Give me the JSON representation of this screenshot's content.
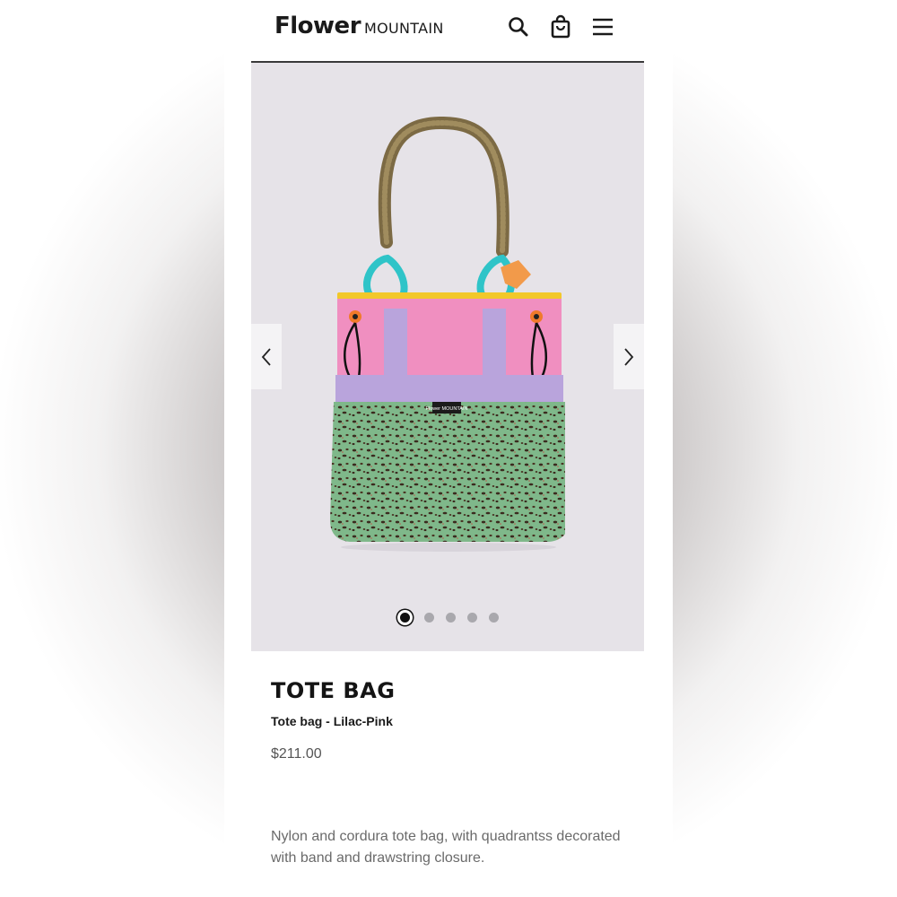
{
  "header": {
    "logo_primary": "Flower",
    "logo_secondary": "MOUNTAIN",
    "icons": [
      "search-icon",
      "shopping-bag-icon",
      "menu-icon"
    ]
  },
  "gallery": {
    "image_alt": "Tote bag - Lilac-Pink",
    "bag_label_text": "Flower MOUNTAIN",
    "slide_count": 5,
    "active_slide": 1,
    "prev_icon": "chevron-left-icon",
    "next_icon": "chevron-right-icon"
  },
  "product": {
    "title": "TOTE BAG",
    "subtitle": "Tote bag - Lilac-Pink",
    "price": "$211.00",
    "description": "Nylon and cordura tote bag, with quadrantss decorated with band and drawstring closure."
  },
  "colors": {
    "gallery_bg": "#e6e3e8",
    "bag_pink": "#f08fc0",
    "bag_lilac": "#b9a4dc",
    "bag_green": "#7fb88a",
    "handle_teal": "#2fc4c8",
    "strap_brown": "#8f7a4f",
    "rim_yellow": "#f2c82a"
  }
}
